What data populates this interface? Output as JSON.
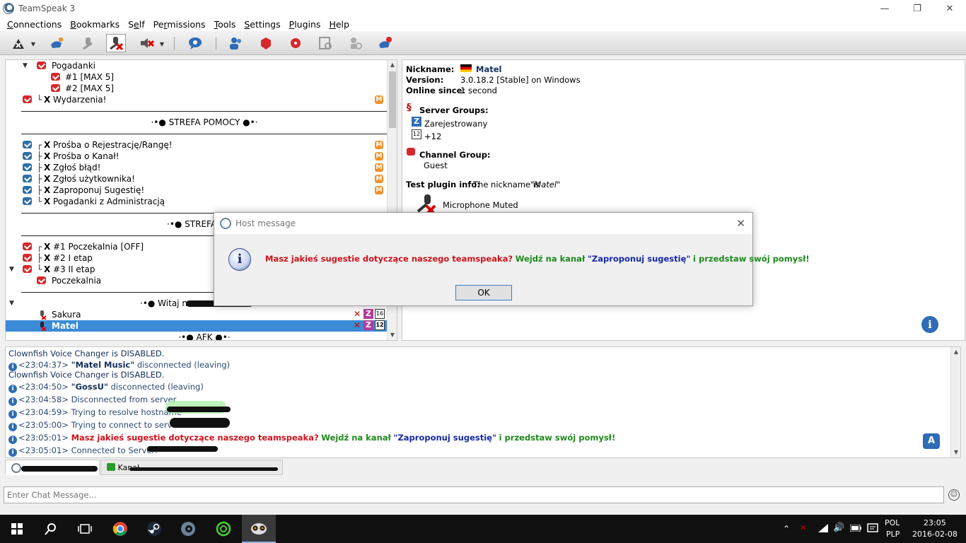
{
  "window": {
    "title": "TeamSpeak 3"
  },
  "menu": [
    "Connections",
    "Bookmarks",
    "Self",
    "Permissions",
    "Tools",
    "Settings",
    "Plugins",
    "Help"
  ],
  "menu_underline": [
    "C",
    "B",
    "e",
    "r",
    "T",
    "S",
    "P",
    "H"
  ],
  "tree": {
    "channels": {
      "pogadanki": "Pogadanki",
      "max5_1": "#1 [MAX 5]",
      "max5_2": "#2 [MAX 5]",
      "wydarzenia": "Wydarzenia!",
      "spacer_pomocy": "·•● STREFA POMOCY ●•·",
      "prosba_rejestracja": "Prośba o Rejestrację/Rangę!",
      "prosba_kanal": "Prośba o Kanał!",
      "zglos_blad": "Zgłoś błąd!",
      "zglos_uzytkownika": "Zgłoś użytkownika!",
      "zaproponuj_sugestie": "Zaproponuj Sugestię!",
      "pogadanki_admin": "Pogadanki z Administracją",
      "spacer_rekrutacji": "·•● STREFA REKR",
      "poczekalnia_off": "#1 Poczekalnia [OFF]",
      "etap1": "#2 I etap",
      "etap2": "#3 II etap",
      "poczekalnia": "Poczekalnia",
      "spacer_witaj": "·•● Witaj na",
      "spacer_afk": "·•● AFK ●•·"
    },
    "prefix_x": "X",
    "mbadge": "M",
    "users": [
      {
        "name": "Sakura",
        "group_badge": "Z",
        "level_badge": "16"
      },
      {
        "name": "Matel",
        "group_badge": "Z",
        "level_badge": "12"
      }
    ]
  },
  "info": {
    "nickname_label": "Nickname:",
    "nickname_value": "Matel",
    "version_label": "Version:",
    "version_value": "3.0.18.2 [Stable] on Windows",
    "online_label": "Online since:",
    "online_value": "1 second",
    "server_groups_label": "Server Groups:",
    "server_group_1": "Zarejestrowany",
    "server_group_1_badge": "Z",
    "server_group_2": "+12",
    "channel_group_label": "Channel Group:",
    "channel_group_value": "Guest",
    "plugin_label": "Test plugin info:",
    "plugin_value_prefix": "The nickname is",
    "plugin_value_name": "\"Matel\"",
    "mic_status": "Microphone Muted"
  },
  "chat_log": {
    "line1": "Clownfish Voice Changer is DISABLED.",
    "line2_time": "<23:04:37>",
    "line2_name": "\"Matel Music\"",
    "line2_text": "disconnected (leaving)",
    "line3": "Clownfish Voice Changer is DISABLED.",
    "line4_time": "<23:04:50>",
    "line4_name": "\"GossU\"",
    "line4_text": "disconnected (leaving)",
    "line5": "<23:04:58> Disconnected from server",
    "line6": "<23:04:59> Trying to resolve hostname",
    "line7": "<23:05:00> Trying to connect to server at",
    "line8_time": "<23:05:01>",
    "line8_red": "Masz jakieś sugestie dotyczące naszego teamspeaka?",
    "line8_green1": "Wejdź na kanał",
    "line8_blue": "\"Zaproponuj sugestię\"",
    "line8_green2": "i przedstaw swój pomysł!",
    "line9": "<23:05:01> Connected to Server: \""
  },
  "tabs": {
    "second_tab": "Kanał"
  },
  "chat_input": {
    "placeholder": "Enter Chat Message..."
  },
  "modal": {
    "title": "Host message",
    "msg_red": "Masz jakieś sugestie dotyczące naszego teamspeaka?",
    "msg_green1": "Wejdź na kanał",
    "msg_blue": "\"Zaproponuj sugestię\"",
    "msg_green2": "i przedstaw swój pomysł!",
    "ok": "OK"
  },
  "taskbar": {
    "lang1": "POL",
    "lang2": "PLP",
    "time": "23:05",
    "date": "2016-02-08"
  },
  "colors": {
    "accent": "#3b8bd6",
    "red_msg": "#d0121b",
    "green_msg": "#1d8a1d",
    "blue_msg": "#1428a8"
  }
}
